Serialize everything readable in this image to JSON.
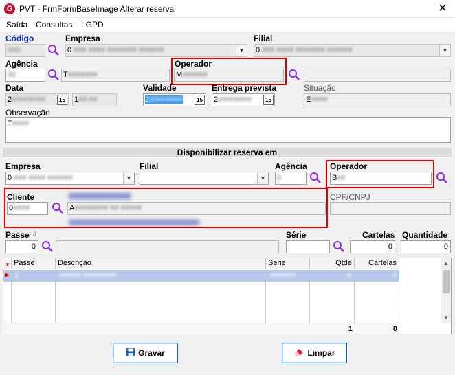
{
  "window": {
    "title": "PVT - FrmFormBaseImage Alterar reserva",
    "app_icon_letter": "G",
    "close_glyph": "✕"
  },
  "menu": [
    "Saída",
    "Consultas",
    "LGPD"
  ],
  "top": {
    "codigo_label": "Código",
    "empresa_label": "Empresa",
    "empresa_value": "0",
    "filial_label": "Filial",
    "filial_value": "0",
    "agencia_label": "Agência",
    "agencia_name": "T",
    "operador_label": "Operador",
    "operador_value": "M",
    "data_label": "Data",
    "data_value": "2",
    "data_time": "1",
    "validade_label": "Validade",
    "validade_value": "2",
    "entrega_label": "Entrega prevista",
    "entrega_value": "2",
    "situacao_label": "Situação",
    "situacao_value": "E",
    "observacao_label": "Observação",
    "observacao_value": "T",
    "cal_glyph": "15"
  },
  "section": {
    "title": "Disponibilizar reserva em"
  },
  "dest": {
    "empresa_label": "Empresa",
    "empresa_value": "0",
    "filial_label": "Filial",
    "agencia_label": "Agência",
    "operador_label": "Operador",
    "operador_value": "B",
    "cliente_label": "Cliente",
    "cliente_value": "0",
    "cliente_name": "A",
    "cpf_label": "CPF/CNPJ",
    "passe_label": "Passe",
    "passe_value": "0",
    "serie_label": "Série",
    "cartelas_label": "Cartelas",
    "cartelas_value": "0",
    "quantidade_label": "Quantidade",
    "quantidade_value": "0"
  },
  "grid": {
    "columns": [
      "Passe",
      "Descrição",
      "Série",
      "Qtde",
      "Cartelas"
    ],
    "rows": [
      {
        "passe": "1",
        "descricao": "",
        "serie": "",
        "qtde": "",
        "cartelas": ""
      }
    ],
    "totals": {
      "qtde": "1",
      "cartelas": "0"
    }
  },
  "buttons": {
    "gravar": "Gravar",
    "limpar": "Limpar"
  },
  "colors": {
    "highlight_red": "#e00000",
    "label_blue": "#0a2bb8",
    "search_purple": "#8a2be2",
    "selection_blue": "#3399ff"
  }
}
